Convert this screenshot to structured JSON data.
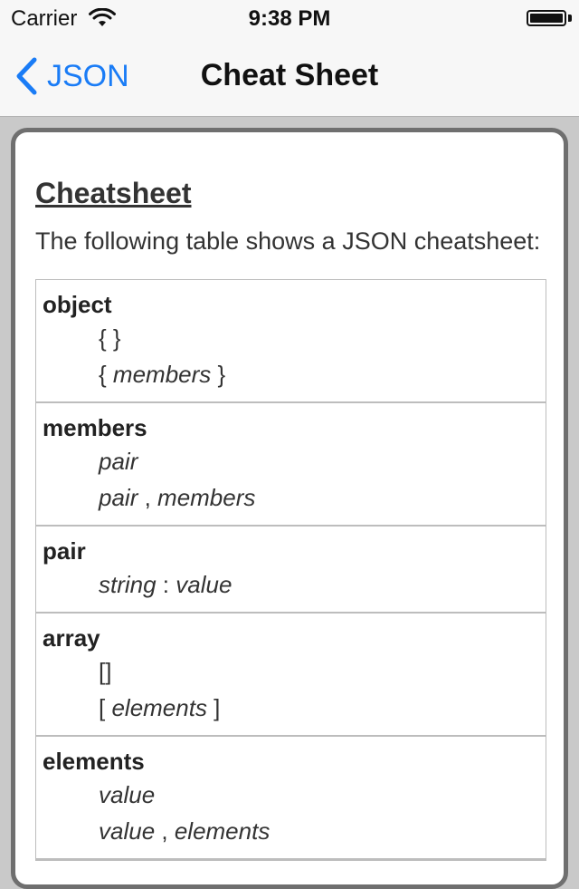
{
  "status_bar": {
    "carrier": "Carrier",
    "time": "9:38 PM"
  },
  "nav": {
    "back_label": "JSON",
    "title": "Cheat Sheet"
  },
  "content": {
    "heading": "Cheatsheet",
    "intro": "The following table shows a JSON cheatsheet:"
  },
  "grammar": [
    {
      "term": "object",
      "productions": [
        [
          {
            "t": "{ }",
            "i": false
          }
        ],
        [
          {
            "t": "{ ",
            "i": false
          },
          {
            "t": "members",
            "i": true
          },
          {
            "t": " }",
            "i": false
          }
        ]
      ]
    },
    {
      "term": "members",
      "productions": [
        [
          {
            "t": "pair",
            "i": true
          }
        ],
        [
          {
            "t": "pair",
            "i": true
          },
          {
            "t": " , ",
            "i": false
          },
          {
            "t": "members",
            "i": true
          }
        ]
      ]
    },
    {
      "term": "pair",
      "productions": [
        [
          {
            "t": "string",
            "i": true
          },
          {
            "t": " : ",
            "i": false
          },
          {
            "t": "value",
            "i": true
          }
        ]
      ]
    },
    {
      "term": "array",
      "productions": [
        [
          {
            "t": "[]",
            "i": false
          }
        ],
        [
          {
            "t": "[ ",
            "i": false
          },
          {
            "t": "elements",
            "i": true
          },
          {
            "t": " ]",
            "i": false
          }
        ]
      ]
    },
    {
      "term": "elements",
      "productions": [
        [
          {
            "t": "value",
            "i": true
          }
        ],
        [
          {
            "t": "value",
            "i": true
          },
          {
            "t": " , ",
            "i": false
          },
          {
            "t": "elements",
            "i": true
          }
        ]
      ]
    }
  ],
  "colors": {
    "accent": "#1a7cf6",
    "card_border": "#6f6f6f",
    "background": "#c9c9c9"
  },
  "icons": {
    "back": "chevron-left-icon",
    "wifi": "wifi-icon",
    "battery": "battery-icon"
  }
}
